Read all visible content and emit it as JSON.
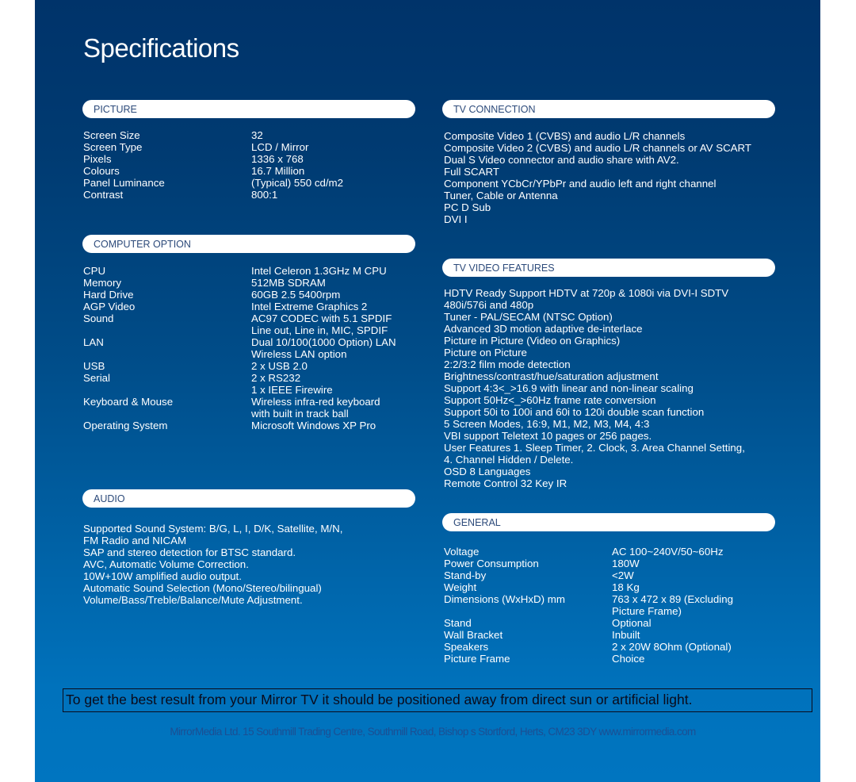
{
  "title": "Specifications",
  "sections": {
    "picture": {
      "header": "PICTURE",
      "rows": [
        {
          "label": "Screen Size",
          "value": [
            "32"
          ]
        },
        {
          "label": "Screen Type",
          "value": [
            "LCD / Mirror"
          ]
        },
        {
          "label": "Pixels",
          "value": [
            "1336 x 768"
          ]
        },
        {
          "label": "Colours",
          "value": [
            "16.7 Million"
          ]
        },
        {
          "label": "Panel Luminance",
          "value": [
            "(Typical) 550 cd/m2"
          ]
        },
        {
          "label": "Contrast",
          "value": [
            "800:1"
          ]
        }
      ]
    },
    "computer_option": {
      "header": "COMPUTER OPTION",
      "rows": [
        {
          "label": "CPU",
          "value": [
            "Intel Celeron 1.3GHz M CPU"
          ]
        },
        {
          "label": "Memory",
          "value": [
            "512MB SDRAM"
          ]
        },
        {
          "label": "Hard Drive",
          "value": [
            "60GB 2.5  5400rpm"
          ]
        },
        {
          "label": "AGP Video",
          "value": [
            "Intel Extreme Graphics 2"
          ]
        },
        {
          "label": "Sound",
          "value": [
            "AC97 CODEC with  5.1 SPDIF",
            "Line out, Line in, MIC, SPDIF"
          ]
        },
        {
          "label": "LAN",
          "value": [
            "Dual 10/100(1000 Option) LAN",
            "Wireless LAN option"
          ]
        },
        {
          "label": "USB",
          "value": [
            "2 x USB 2.0"
          ]
        },
        {
          "label": "Serial",
          "value": [
            "2 x RS232",
            "1 x IEEE Firewire"
          ]
        },
        {
          "label": "Keyboard & Mouse",
          "value": [
            "Wireless infra-red keyboard",
            "with built in track ball"
          ]
        },
        {
          "label": "Operating System",
          "value": [
            "Microsoft Windows XP Pro"
          ]
        }
      ]
    },
    "audio": {
      "header": "AUDIO",
      "lines": [
        "Supported Sound System: B/G, L, I, D/K, Satellite, M/N,",
        "FM Radio and NICAM",
        "SAP and stereo detection for BTSC standard.",
        "AVC, Automatic Volume Correction.",
        "10W+10W amplified audio output.",
        "Automatic Sound Selection (Mono/Stereo/bilingual)",
        "Volume/Bass/Treble/Balance/Mute Adjustment."
      ]
    },
    "tv_connection": {
      "header": "TV CONNECTION",
      "lines": [
        "Composite Video 1 (CVBS) and audio L/R channels",
        "Composite Video 2 (CVBS) and audio L/R channels or AV SCART",
        "Dual S Video connector and audio share with AV2.",
        "Full SCART",
        "Component YCbCr/YPbPr and audio left and right channel",
        "Tuner, Cable or Antenna",
        "PC D Sub",
        "DVI I"
      ]
    },
    "tv_video_features": {
      "header": "TV VIDEO FEATURES",
      "lines": [
        "HDTV Ready   Support  HDTV at 720p & 1080i via DVI-I SDTV",
        "480i/576i and 480p",
        "Tuner - PAL/SECAM (NTSC Option)",
        "Advanced 3D motion adaptive de-interlace",
        "Picture in Picture (Video on Graphics)",
        "Picture on Picture",
        "2:2/3:2 film mode detection",
        "Brightness/contrast/hue/saturation adjustment",
        "Support 4:3<_>16.9 with linear and non-linear scaling",
        "Support 50Hz<_>60Hz frame rate conversion",
        "Support 50i to 100i and 60i to 120i double scan function",
        "5 Screen Modes, 16:9, M1, M2, M3, M4, 4:3",
        "VBI support Teletext 10 pages or 256 pages.",
        "User Features 1. Sleep Timer, 2. Clock, 3. Area Channel Setting,",
        "4. Channel Hidden / Delete.",
        "OSD   8 Languages",
        "Remote Control   32 Key IR"
      ]
    },
    "general": {
      "header": "GENERAL",
      "rows": [
        {
          "label": "Voltage",
          "value": [
            "AC 100~240V/50~60Hz"
          ]
        },
        {
          "label": "Power Consumption",
          "value": [
            "180W"
          ]
        },
        {
          "label": "Stand-by",
          "value": [
            "<2W"
          ]
        },
        {
          "label": "Weight",
          "value": [
            "18 Kg"
          ]
        },
        {
          "label": "Dimensions (WxHxD) mm",
          "value": [
            "763 x 472 x 89 (Excluding",
            "Picture Frame)"
          ]
        },
        {
          "label": "Stand",
          "value": [
            "Optional"
          ]
        },
        {
          "label": "Wall Bracket",
          "value": [
            "Inbuilt"
          ]
        },
        {
          "label": "Speakers",
          "value": [
            "2 x 20W 8Ohm (Optional)"
          ]
        },
        {
          "label": "Picture Frame",
          "value": [
            "Choice"
          ]
        }
      ]
    }
  },
  "notice": "To get the best result from your Mirror TV it should be positioned away from direct sun or artificial light.",
  "footer": "MirrorMedia Ltd. 15 Southmill Trading Centre, Southmill Road, Bishop s Stortford, Herts, CM23 3DY  www.mirrormedia.com"
}
